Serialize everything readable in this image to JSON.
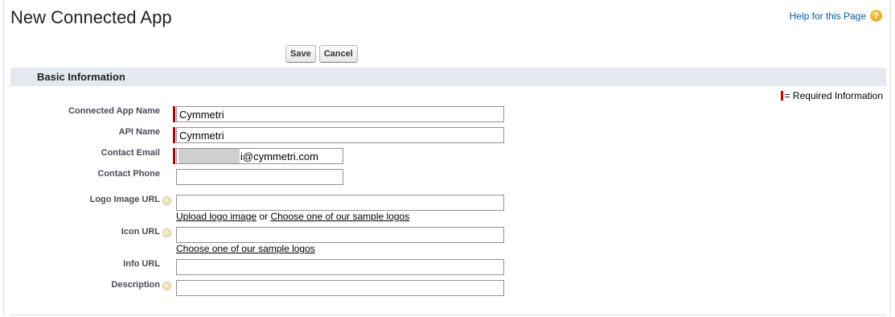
{
  "page": {
    "title": "New Connected App"
  },
  "help": {
    "label": "Help for this Page",
    "icon": "question-icon",
    "icon_glyph": "?"
  },
  "buttons": {
    "save": "Save",
    "cancel": "Cancel"
  },
  "section": {
    "title": "Basic Information"
  },
  "required_legend": "= Required Information",
  "fields": {
    "app_name": {
      "label": "Connected App Name",
      "value": "Cymmetri",
      "required": true
    },
    "api_name": {
      "label": "API Name",
      "value": "Cymmetri",
      "required": true
    },
    "email": {
      "label": "Contact Email",
      "value": "i@cymmetri.com",
      "required": true
    },
    "phone": {
      "label": "Contact Phone",
      "value": ""
    },
    "logo_url": {
      "label": "Logo Image URL",
      "value": "",
      "upload_link": "Upload logo image",
      "or_text": "or",
      "sample_link": "Choose one of our sample logos"
    },
    "icon_url": {
      "label": "Icon URL",
      "value": "",
      "sample_link": "Choose one of our sample logos"
    },
    "info_url": {
      "label": "Info URL",
      "value": ""
    },
    "description": {
      "label": "Description",
      "value": ""
    }
  },
  "colors": {
    "required": "#b20000",
    "section_bg": "#e3e9ef",
    "link": "#015ba7"
  }
}
